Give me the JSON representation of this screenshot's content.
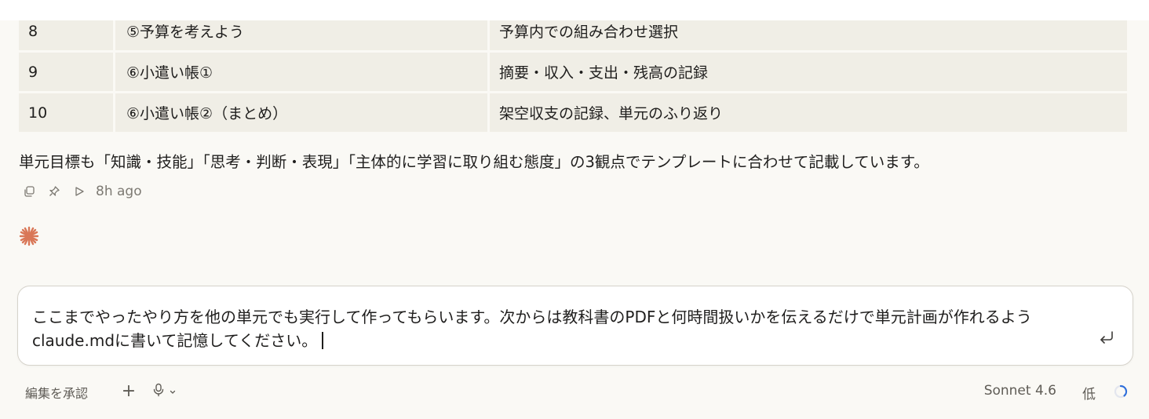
{
  "table": {
    "rows": [
      {
        "no": "8",
        "title": "⑤予算を考えよう",
        "content": "予算内での組み合わせ選択"
      },
      {
        "no": "9",
        "title": "⑥小遣い帳①",
        "content": "摘要・収入・支出・残高の記録"
      },
      {
        "no": "10",
        "title": "⑥小遣い帳②（まとめ）",
        "content": "架空収支の記録、単元のふり返り"
      }
    ]
  },
  "message": {
    "summary": "単元目標も「知識・技能」「思考・判断・表現」「主体的に学習に取り組む態度」の3観点でテンプレートに合わせて記載しています。",
    "timestamp": "8h ago",
    "icons": [
      "copy-icon",
      "pin-icon",
      "play-icon"
    ]
  },
  "composer": {
    "text": "ここまでやったやり方を他の単元でも実行して作ってもらいます。次からは教科書のPDFと何時間扱いかを伝えるだけで単元計画が作れるようclaude.mdに書いて記憶してください。"
  },
  "bottom_bar": {
    "accept_edits_label": "編集を承認",
    "plus_label": "+",
    "model_label": "Sonnet 4.6",
    "effort_label": "低"
  },
  "colors": {
    "background": "#faf9f5",
    "table_cell": "#f0eee6",
    "accent": "#d97757",
    "spinner": "#2f6fdb"
  }
}
